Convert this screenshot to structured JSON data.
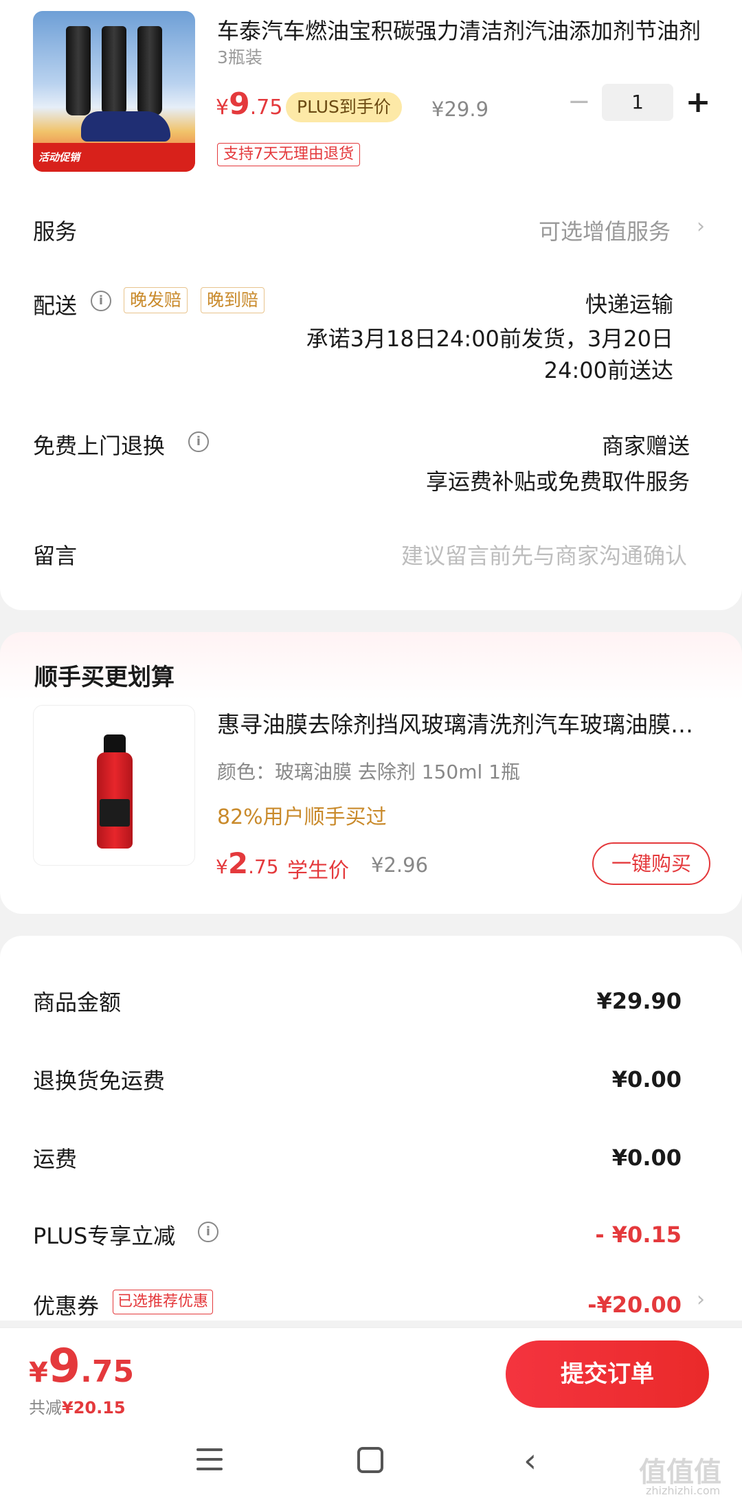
{
  "product": {
    "title": "车泰汽车燃油宝积碳强力清洁剂汽油添加剂节油剂",
    "variant": "3瓶装",
    "price_yen": "¥",
    "price_int": "9",
    "price_dec": ".75",
    "plus_badge": "PLUS到手价",
    "original_price": "¥29.9",
    "quantity": "1",
    "minus": "−",
    "plus": "+",
    "return_tag": "支持7天无理由退货",
    "thumb_promo": "活动促销"
  },
  "rows": {
    "service_label": "服务",
    "service_value": "可选增值服务",
    "delivery_label": "配送",
    "delivery_tag1": "晚发赔",
    "delivery_tag2": "晚到赔",
    "delivery_method": "快递运输",
    "delivery_promise_1": "承诺3月18日24:00前发货，3月20日",
    "delivery_promise_2": "24:00前送达",
    "return_label": "免费上门退换",
    "return_value_1": "商家赠送",
    "return_value_2": "享运费补贴或免费取件服务",
    "message_label": "留言",
    "message_placeholder": "建议留言前先与商家沟通确认"
  },
  "upsell": {
    "section_title": "顺手买更划算",
    "title": "惠寻油膜去除剂挡风玻璃清洗剂汽车玻璃油膜去除",
    "variant": "颜色：玻璃油膜 去除剂 150ml 1瓶",
    "social": "82%用户顺手买过",
    "price_yen": "¥",
    "price_int": "2",
    "price_dec": ".75",
    "price_label": "学生价",
    "original_price": "¥2.96",
    "buy_button": "一键购买"
  },
  "summary": {
    "goods_label": "商品金额",
    "goods_value": "¥29.90",
    "return_ship_label": "退换货免运费",
    "return_ship_value": "¥0.00",
    "freight_label": "运费",
    "freight_value": "¥0.00",
    "plus_label": "PLUS专享立减",
    "plus_value": "- ¥0.15",
    "coupon_label": "优惠券",
    "coupon_tag": "已选推荐优惠",
    "coupon_value": "-¥20.00"
  },
  "footer": {
    "total_yen": "¥",
    "total_int": "9",
    "total_dec": ".75",
    "discount_prefix": "共减",
    "discount_value": "¥20.15",
    "submit_label": "提交订单"
  },
  "watermark": {
    "text": "值值值",
    "sub": "zhizhizhi.com"
  },
  "colors": {
    "accent_red": "#e4393c",
    "gold": "#c98a2b",
    "plus_badge_bg": "#fde9a7"
  }
}
